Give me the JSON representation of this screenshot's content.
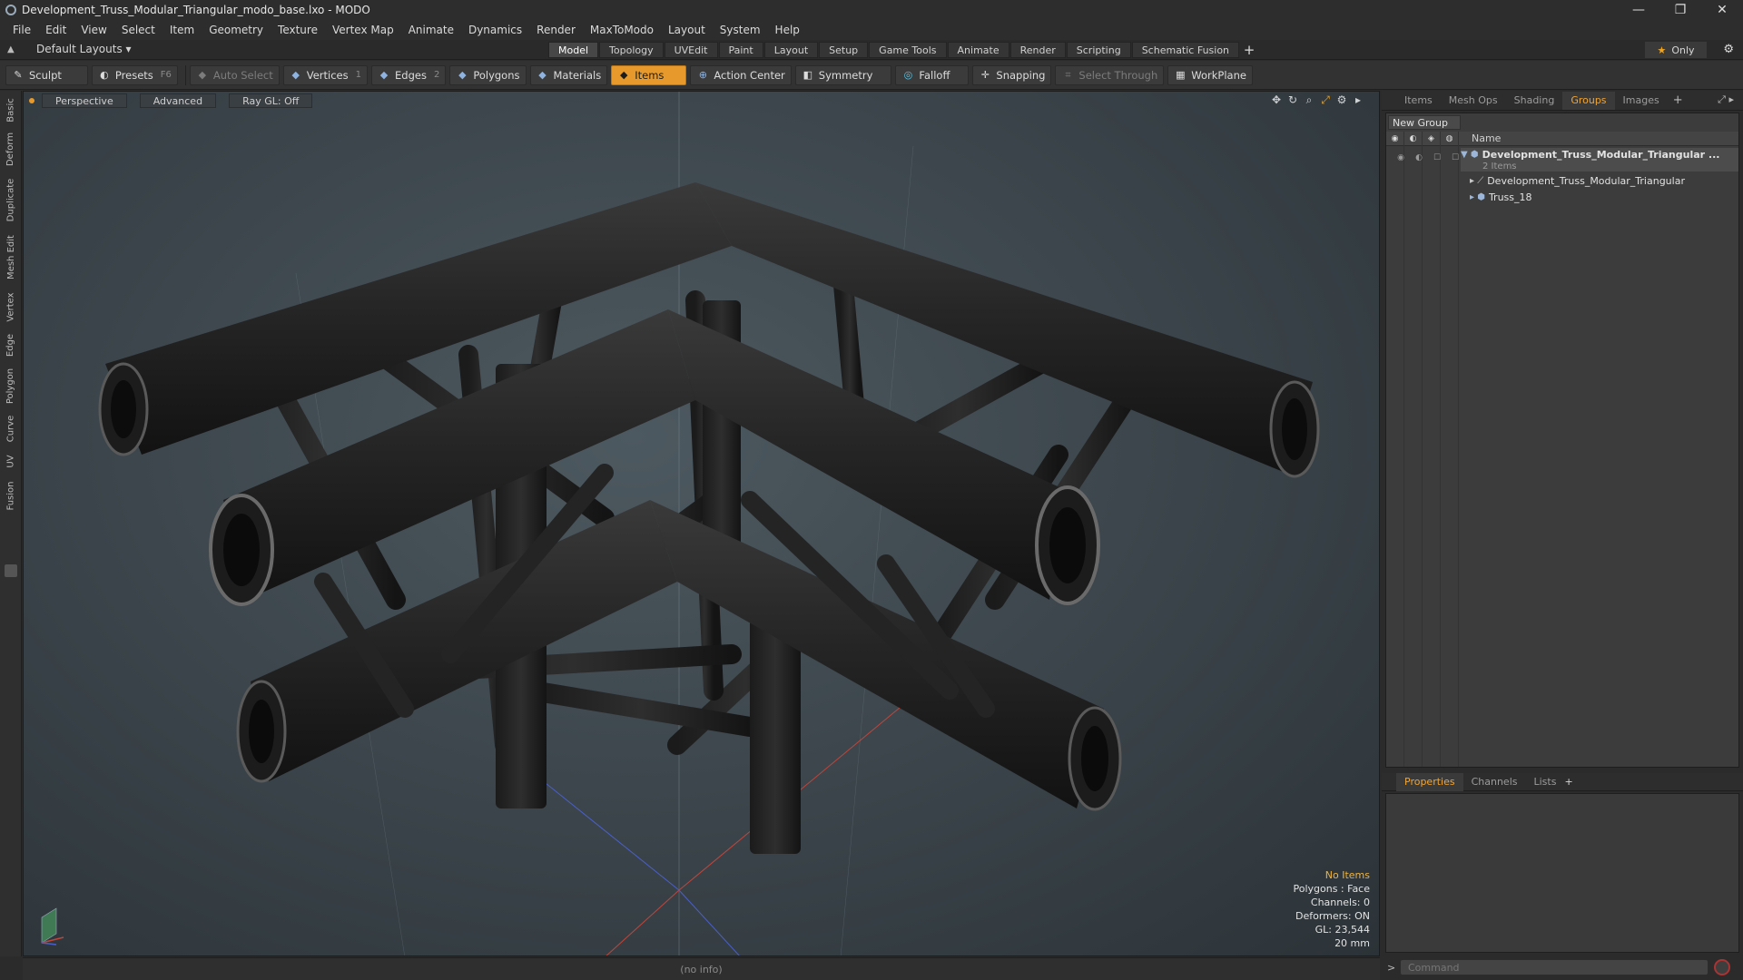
{
  "window": {
    "title": "Development_Truss_Modular_Triangular_modo_base.lxo - MODO",
    "controls": [
      "—",
      "❐",
      "✕"
    ]
  },
  "menu": [
    "File",
    "Edit",
    "View",
    "Select",
    "Item",
    "Geometry",
    "Texture",
    "Vertex Map",
    "Animate",
    "Dynamics",
    "Render",
    "MaxToModo",
    "Layout",
    "System",
    "Help"
  ],
  "layouts": {
    "label": "Default Layouts ▾"
  },
  "mode_tabs": [
    {
      "label": "Model",
      "active": true
    },
    {
      "label": "Topology"
    },
    {
      "label": "UVEdit"
    },
    {
      "label": "Paint"
    },
    {
      "label": "Layout"
    },
    {
      "label": "Setup"
    },
    {
      "label": "Game Tools"
    },
    {
      "label": "Animate"
    },
    {
      "label": "Render"
    },
    {
      "label": "Scripting"
    },
    {
      "label": "Schematic Fusion"
    }
  ],
  "only_label": "Only",
  "toolbar": {
    "sculpt": "Sculpt",
    "presets": "Presets",
    "presets_key": "F6",
    "auto_select": "Auto Select",
    "vertices": "Vertices",
    "vertices_key": "1",
    "edges": "Edges",
    "edges_key": "2",
    "polygons": "Polygons",
    "materials": "Materials",
    "items": "Items",
    "action_center": "Action Center",
    "symmetry": "Symmetry",
    "falloff": "Falloff",
    "snapping": "Snapping",
    "select_through": "Select Through",
    "workplane": "WorkPlane"
  },
  "left_tabs": [
    "Basic",
    "Deform",
    "Duplicate",
    "Mesh Edit",
    "Vertex",
    "Edge",
    "Polygon",
    "Curve",
    "UV",
    "Fusion"
  ],
  "viewport": {
    "perspective": "Perspective",
    "advanced": "Advanced",
    "raygl": "Ray GL: Off",
    "info": {
      "no_items": "No Items",
      "polygons": "Polygons : Face",
      "channels": "Channels: 0",
      "deformers": "Deformers: ON",
      "gl": "GL: 23,544",
      "scale": "20 mm"
    }
  },
  "status": "(no info)",
  "right_tabs": [
    "Items",
    "Mesh Ops",
    "Shading",
    "Groups",
    "Images"
  ],
  "right_active": "Groups",
  "groups": {
    "new_group": "New Group",
    "name_col": "Name",
    "root": "Development_Truss_Modular_Triangular ...",
    "count": "2 Items",
    "children": [
      "Development_Truss_Modular_Triangular",
      "Truss_18"
    ]
  },
  "props_tabs": [
    "Properties",
    "Channels",
    "Lists"
  ],
  "command": {
    "placeholder": "Command"
  }
}
